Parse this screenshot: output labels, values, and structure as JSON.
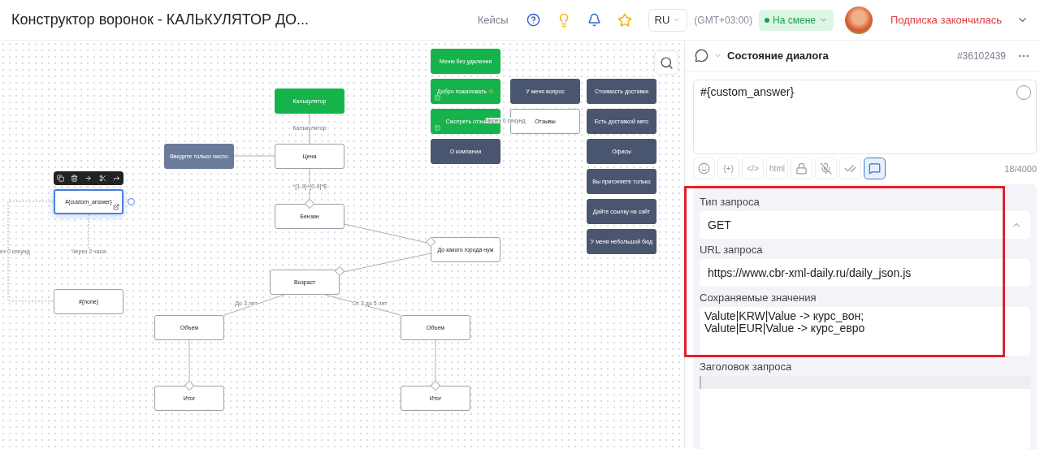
{
  "header": {
    "title": "Конструктор воронок - КАЛЬКУЛЯТОР ДО...",
    "nav_link": "Кейсы",
    "language": "RU",
    "timezone": "(GMT+03:00)",
    "status": {
      "label": "На смене",
      "on": true
    },
    "subscription": "Подписка закончилась"
  },
  "canvas": {
    "nodes": [
      {
        "label": "Калькулятор",
        "kind": "green",
        "selected": false
      },
      {
        "label": "Цена",
        "kind": "white",
        "selected": false
      },
      {
        "label": "Введите только число",
        "kind": "slate",
        "selected": false
      },
      {
        "label": "Бензин",
        "kind": "white",
        "selected": false
      },
      {
        "label": "До какого города нуж",
        "kind": "white",
        "selected": false
      },
      {
        "label": "Возраст",
        "kind": "white",
        "selected": false
      },
      {
        "label": "Объем",
        "kind": "white",
        "selected": false
      },
      {
        "label": "Объем",
        "kind": "white",
        "selected": false
      },
      {
        "label": "Итог",
        "kind": "white",
        "selected": false
      },
      {
        "label": "Итог",
        "kind": "white",
        "selected": false
      },
      {
        "label": "#{custom_answer}",
        "kind": "white",
        "selected": true
      },
      {
        "label": "#{none}",
        "kind": "white",
        "selected": false
      },
      {
        "label": "Меню без удаления",
        "kind": "green",
        "selected": false
      },
      {
        "label": "Добро пожаловать",
        "kind": "green",
        "selected": false
      },
      {
        "label": "Смотреть отзы",
        "kind": "green",
        "selected": false
      },
      {
        "label": "О компании",
        "kind": "dark",
        "selected": false
      },
      {
        "label": "У меня вопрос",
        "kind": "dark",
        "selected": false
      },
      {
        "label": "Отзывы",
        "kind": "white",
        "selected": false
      },
      {
        "label": "Стоимость доставки",
        "kind": "dark",
        "selected": false
      },
      {
        "label": "Есть доставкой авто",
        "kind": "dark",
        "selected": false
      },
      {
        "label": "Офисы",
        "kind": "dark",
        "selected": false
      },
      {
        "label": "Вы пригоняете только",
        "kind": "dark",
        "selected": false
      },
      {
        "label": "Дайте ссылку на сайт",
        "kind": "dark",
        "selected": false
      },
      {
        "label": "У меня небольшой бюд",
        "kind": "dark",
        "selected": false
      }
    ],
    "edge_labels": [
      "Калькулятор",
      "^[1-9]+[0-9]*$",
      "ез 0 секунд",
      "Через 2 часа",
      "До 3 лет",
      "От 3 до 5 лет",
      "Через 0 секунд"
    ]
  },
  "panel": {
    "title": "Состояние диалога",
    "id": "#36102439",
    "message": "#{custom_answer}",
    "counter": "18/4000",
    "toolbar": [
      {
        "kind": "emoji",
        "selected": false
      },
      {
        "kind": "text",
        "label": "{+}",
        "selected": false
      },
      {
        "kind": "text",
        "label": "</>",
        "selected": false
      },
      {
        "kind": "text",
        "label": "html",
        "selected": false
      },
      {
        "kind": "lock",
        "selected": false
      },
      {
        "kind": "voice-off",
        "selected": false
      },
      {
        "kind": "double-check",
        "selected": false
      },
      {
        "kind": "message",
        "selected": true
      }
    ],
    "fields": [
      {
        "label": "Тип запроса",
        "kind": "select",
        "value": "GET",
        "highlighted": true
      },
      {
        "label": "URL запроса",
        "kind": "input",
        "value": "https://www.cbr-xml-daily.ru/daily_json.js",
        "highlighted": true
      },
      {
        "label": "Сохраняемые значения",
        "kind": "textarea",
        "value": "Valute|KRW|Value -> курс_вон;\nValute|EUR|Value -> курс_евро",
        "highlighted": true
      },
      {
        "label": "Заголовок запроса",
        "kind": "code",
        "highlighted": false
      }
    ]
  }
}
